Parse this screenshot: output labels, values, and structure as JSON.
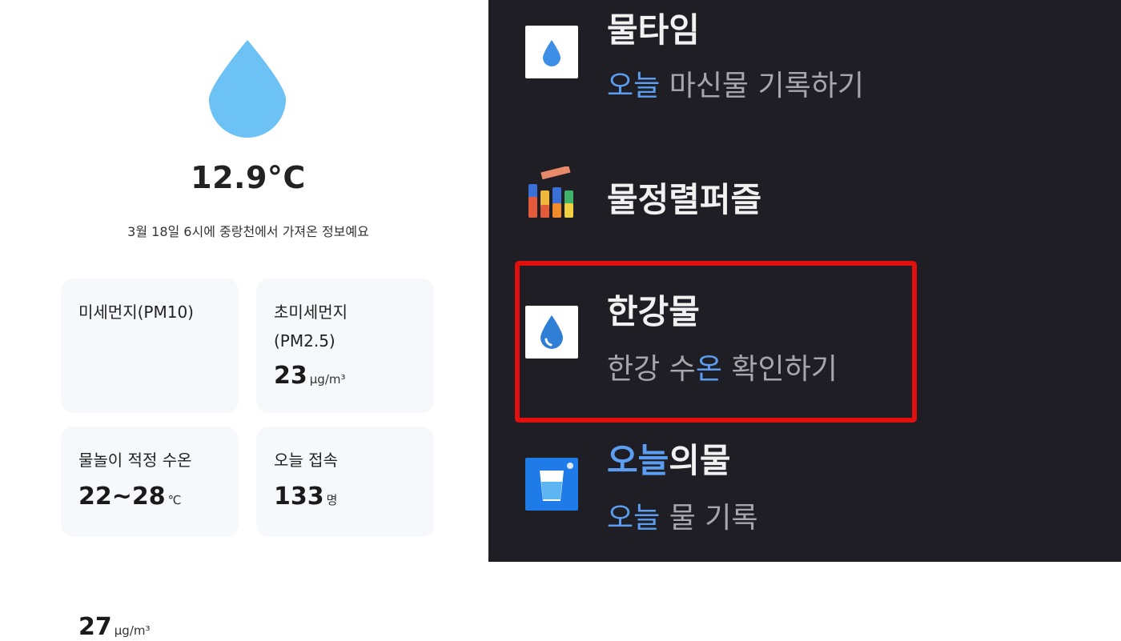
{
  "left": {
    "temperature": "12.9°C",
    "info_text": "3월 18일 6시에 중랑천에서 가져온 정보예요",
    "cards": [
      {
        "label": "미세먼지(PM10)",
        "value": "27",
        "unit": "μg/m³"
      },
      {
        "label_line1": "초미세먼지",
        "label_line2": "(PM2.5)",
        "value": "23",
        "unit": "μg/m³"
      },
      {
        "label": "물놀이 적정 수온",
        "value": "22~28",
        "unit": "℃"
      },
      {
        "label": "오늘 접속",
        "value": "133",
        "unit": "명"
      }
    ],
    "drop_color": "#6cc1f5"
  },
  "right": {
    "background": "#1f1e24",
    "accent": "#5b9df0",
    "highlight_color": "#e20f0f",
    "apps": [
      {
        "name": "물타임",
        "sub_hl": "오늘",
        "sub_rest": " 마신물 기록하기",
        "icon": "water-drop-icon"
      },
      {
        "name": "물정렬퍼즐",
        "icon": "water-sort-bottles-icon"
      },
      {
        "name": "한강물",
        "sub_pre": "한강 수",
        "sub_hl": "온",
        "sub_rest": " 확인하기",
        "icon": "water-drop-icon"
      },
      {
        "name_hl": "오늘",
        "name_rest": "의물",
        "sub_hl": "오늘",
        "sub_rest": " 물 기록",
        "icon": "water-glass-icon"
      }
    ]
  }
}
